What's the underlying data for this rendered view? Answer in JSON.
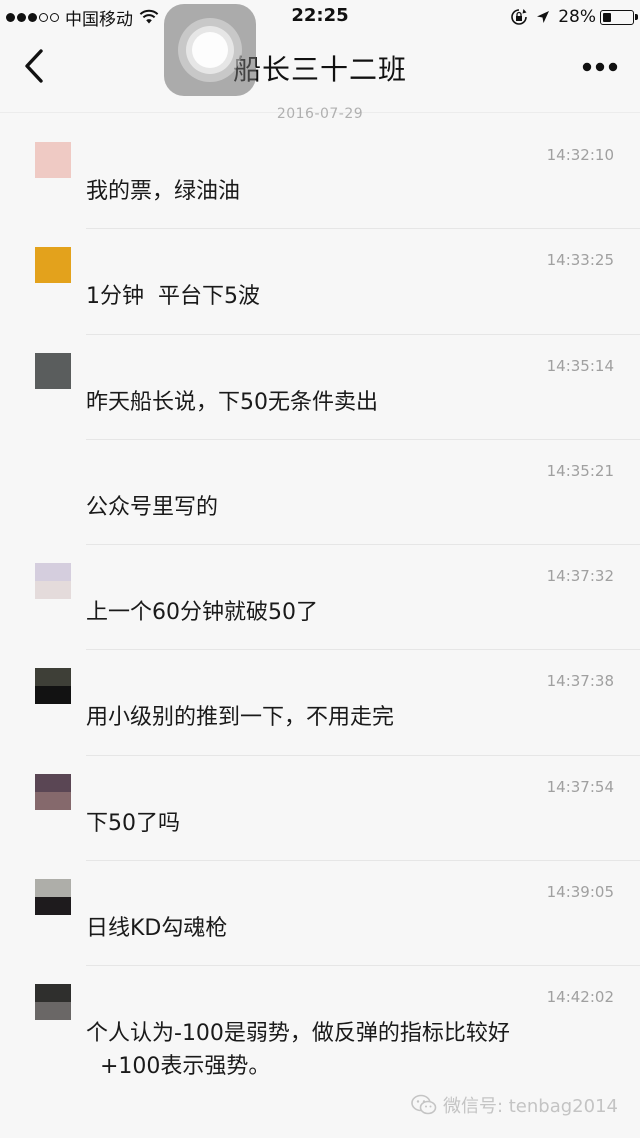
{
  "status_bar": {
    "carrier": "中国移动",
    "time": "22:25",
    "battery": "28%",
    "battery_level": 0.28
  },
  "nav": {
    "title": "船长三十二班"
  },
  "date_label": "2016-07-29",
  "messages": [
    {
      "time": "14:32:10",
      "text": "我的票，绿油油",
      "avatar_colors": [
        "#efcac4",
        "#efcac4"
      ]
    },
    {
      "time": "14:33:25",
      "text": "1分钟  平台下5波",
      "avatar_colors": [
        "#e3a21c",
        "#e3a21c"
      ]
    },
    {
      "time": "14:35:14",
      "text": "昨天船长说，下50无条件卖出",
      "avatar_colors": [
        "#5a5d5d",
        "#5a5d5d"
      ]
    },
    {
      "time": "14:35:21",
      "text": "公众号里写的",
      "avatar_colors": [
        "#f7f7f7",
        "#f7f7f7"
      ]
    },
    {
      "time": "14:37:32",
      "text": "上一个60分钟就破50了",
      "avatar_colors": [
        "#d5cede",
        "#e4dbdb"
      ]
    },
    {
      "time": "14:37:38",
      "text": "用小级别的推到一下，不用走完",
      "avatar_colors": [
        "#3e3f37",
        "#121212"
      ]
    },
    {
      "time": "14:37:54",
      "text": "下50了吗",
      "avatar_colors": [
        "#5a4654",
        "#85696c"
      ]
    },
    {
      "time": "14:39:05",
      "text": "日线KD勾魂枪",
      "avatar_colors": [
        "#aeaea9",
        "#1e1b1d"
      ]
    },
    {
      "time": "14:42:02",
      "text": "个人认为-100是弱势，做反弹的指标比较好\n  +100表示强势。",
      "avatar_colors": [
        "#2f2f2d",
        "#6a6766"
      ]
    }
  ],
  "watermark": {
    "text": "微信号: tenbag2014"
  },
  "icons": {
    "back": "chevron-left-icon",
    "more": "more-dots-icon",
    "wifi": "wifi-icon",
    "location": "location-arrow-icon",
    "lock_rotation": "orientation-lock-icon",
    "battery": "battery-icon",
    "assistive_touch": "assistive-touch-icon",
    "wechat": "wechat-logo-icon"
  }
}
